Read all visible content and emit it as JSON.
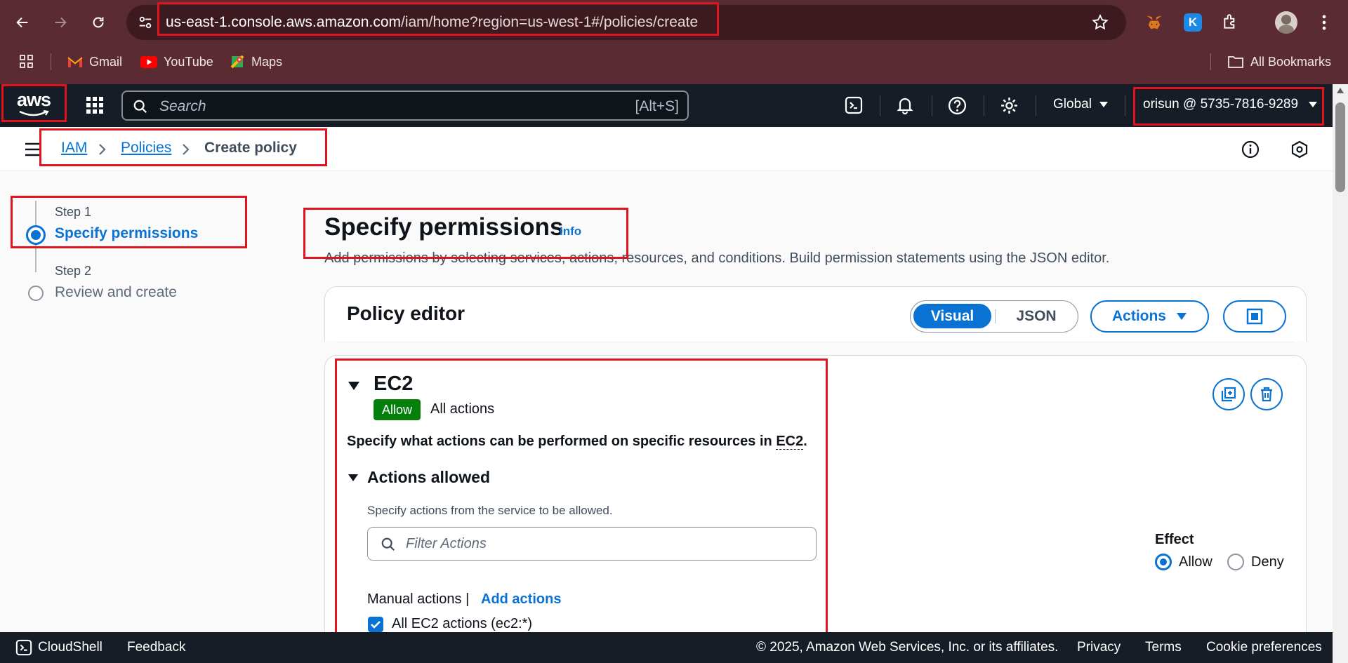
{
  "browser": {
    "url_host": "us-east-1.console.aws.amazon.com",
    "url_path": "/iam/home?region=us-west-1#/policies/create",
    "bookmarks": [
      "Gmail",
      "YouTube",
      "Maps"
    ],
    "all_bookmarks": "All Bookmarks",
    "extension_letter": "K"
  },
  "aws_nav": {
    "logo_text": "aws",
    "search_placeholder": "Search",
    "search_shortcut": "[Alt+S]",
    "region": "Global",
    "account": "orisun @ 5735-7816-9289"
  },
  "breadcrumb": [
    "IAM",
    "Policies",
    "Create policy"
  ],
  "steps": [
    {
      "step": "Step 1",
      "label": "Specify permissions"
    },
    {
      "step": "Step 2",
      "label": "Review and create"
    }
  ],
  "page": {
    "title": "Specify permissions",
    "info": "Info",
    "description": "Add permissions by selecting services, actions, resources, and conditions. Build permission statements using the JSON editor."
  },
  "editor": {
    "title": "Policy editor",
    "tabs": [
      "Visual",
      "JSON"
    ],
    "actions_label": "Actions"
  },
  "statement": {
    "service": "EC2",
    "badge": "Allow",
    "summary": "All actions",
    "heading_prefix": "Specify what actions can be performed on specific resources in ",
    "heading_service": "EC2",
    "heading_suffix": ".",
    "actions_allowed": "Actions allowed",
    "actions_desc": "Specify actions from the service to be allowed.",
    "filter_placeholder": "Filter Actions",
    "manual_actions": "Manual actions |",
    "add_actions": "Add actions",
    "all_actions_checkbox": "All EC2 actions (ec2:*)",
    "effect_label": "Effect",
    "effect_options": [
      "Allow",
      "Deny"
    ]
  },
  "footer": {
    "cloudshell": "CloudShell",
    "feedback": "Feedback",
    "copyright": "© 2025, Amazon Web Services, Inc. or its affiliates.",
    "links": [
      "Privacy",
      "Terms",
      "Cookie preferences"
    ]
  },
  "colors": {
    "chrome": "#5b2b33",
    "aws_nav": "#161d26",
    "link_blue": "#0972d3",
    "allow_green": "#037f0c",
    "annotation_red": "#e0141e"
  }
}
